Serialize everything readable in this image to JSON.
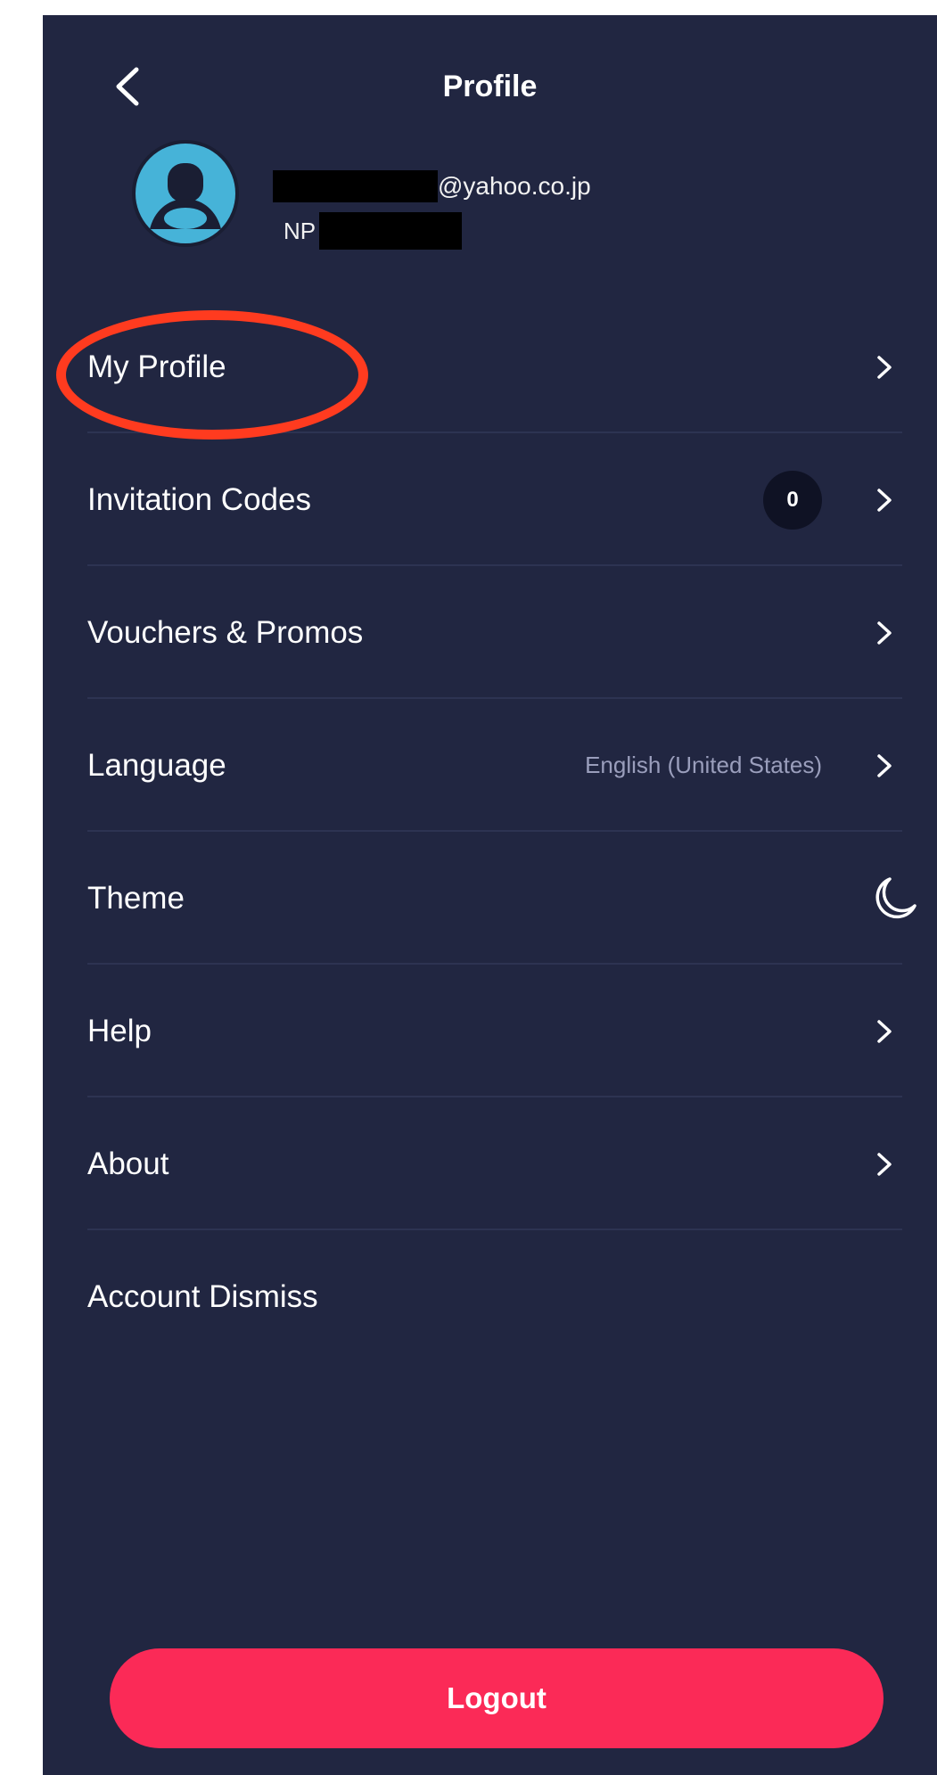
{
  "header": {
    "title": "Profile",
    "back_icon": "chevron-left-icon"
  },
  "user": {
    "avatar_icon": "user-avatar-icon",
    "avatar_color": "#46b3d8",
    "email_suffix": "@yahoo.co.jp",
    "id_prefix": "NP"
  },
  "menu": {
    "items": [
      {
        "label": "My Profile",
        "icon": "chevron-right-icon"
      },
      {
        "label": "Invitation Codes",
        "badge": "0",
        "icon": "chevron-right-icon"
      },
      {
        "label": "Vouchers & Promos",
        "icon": "chevron-right-icon"
      },
      {
        "label": "Language",
        "value": "English (United States)",
        "icon": "chevron-right-icon"
      },
      {
        "label": "Theme",
        "icon": "moon-icon"
      },
      {
        "label": "Help",
        "icon": "chevron-right-icon"
      },
      {
        "label": "About",
        "icon": "chevron-right-icon"
      },
      {
        "label": "Account Dismiss"
      }
    ]
  },
  "logout": {
    "label": "Logout"
  },
  "colors": {
    "background": "#212641",
    "accent": "#fb2a57",
    "highlight": "#ff3b1f",
    "badge_bg": "#0f1224"
  }
}
